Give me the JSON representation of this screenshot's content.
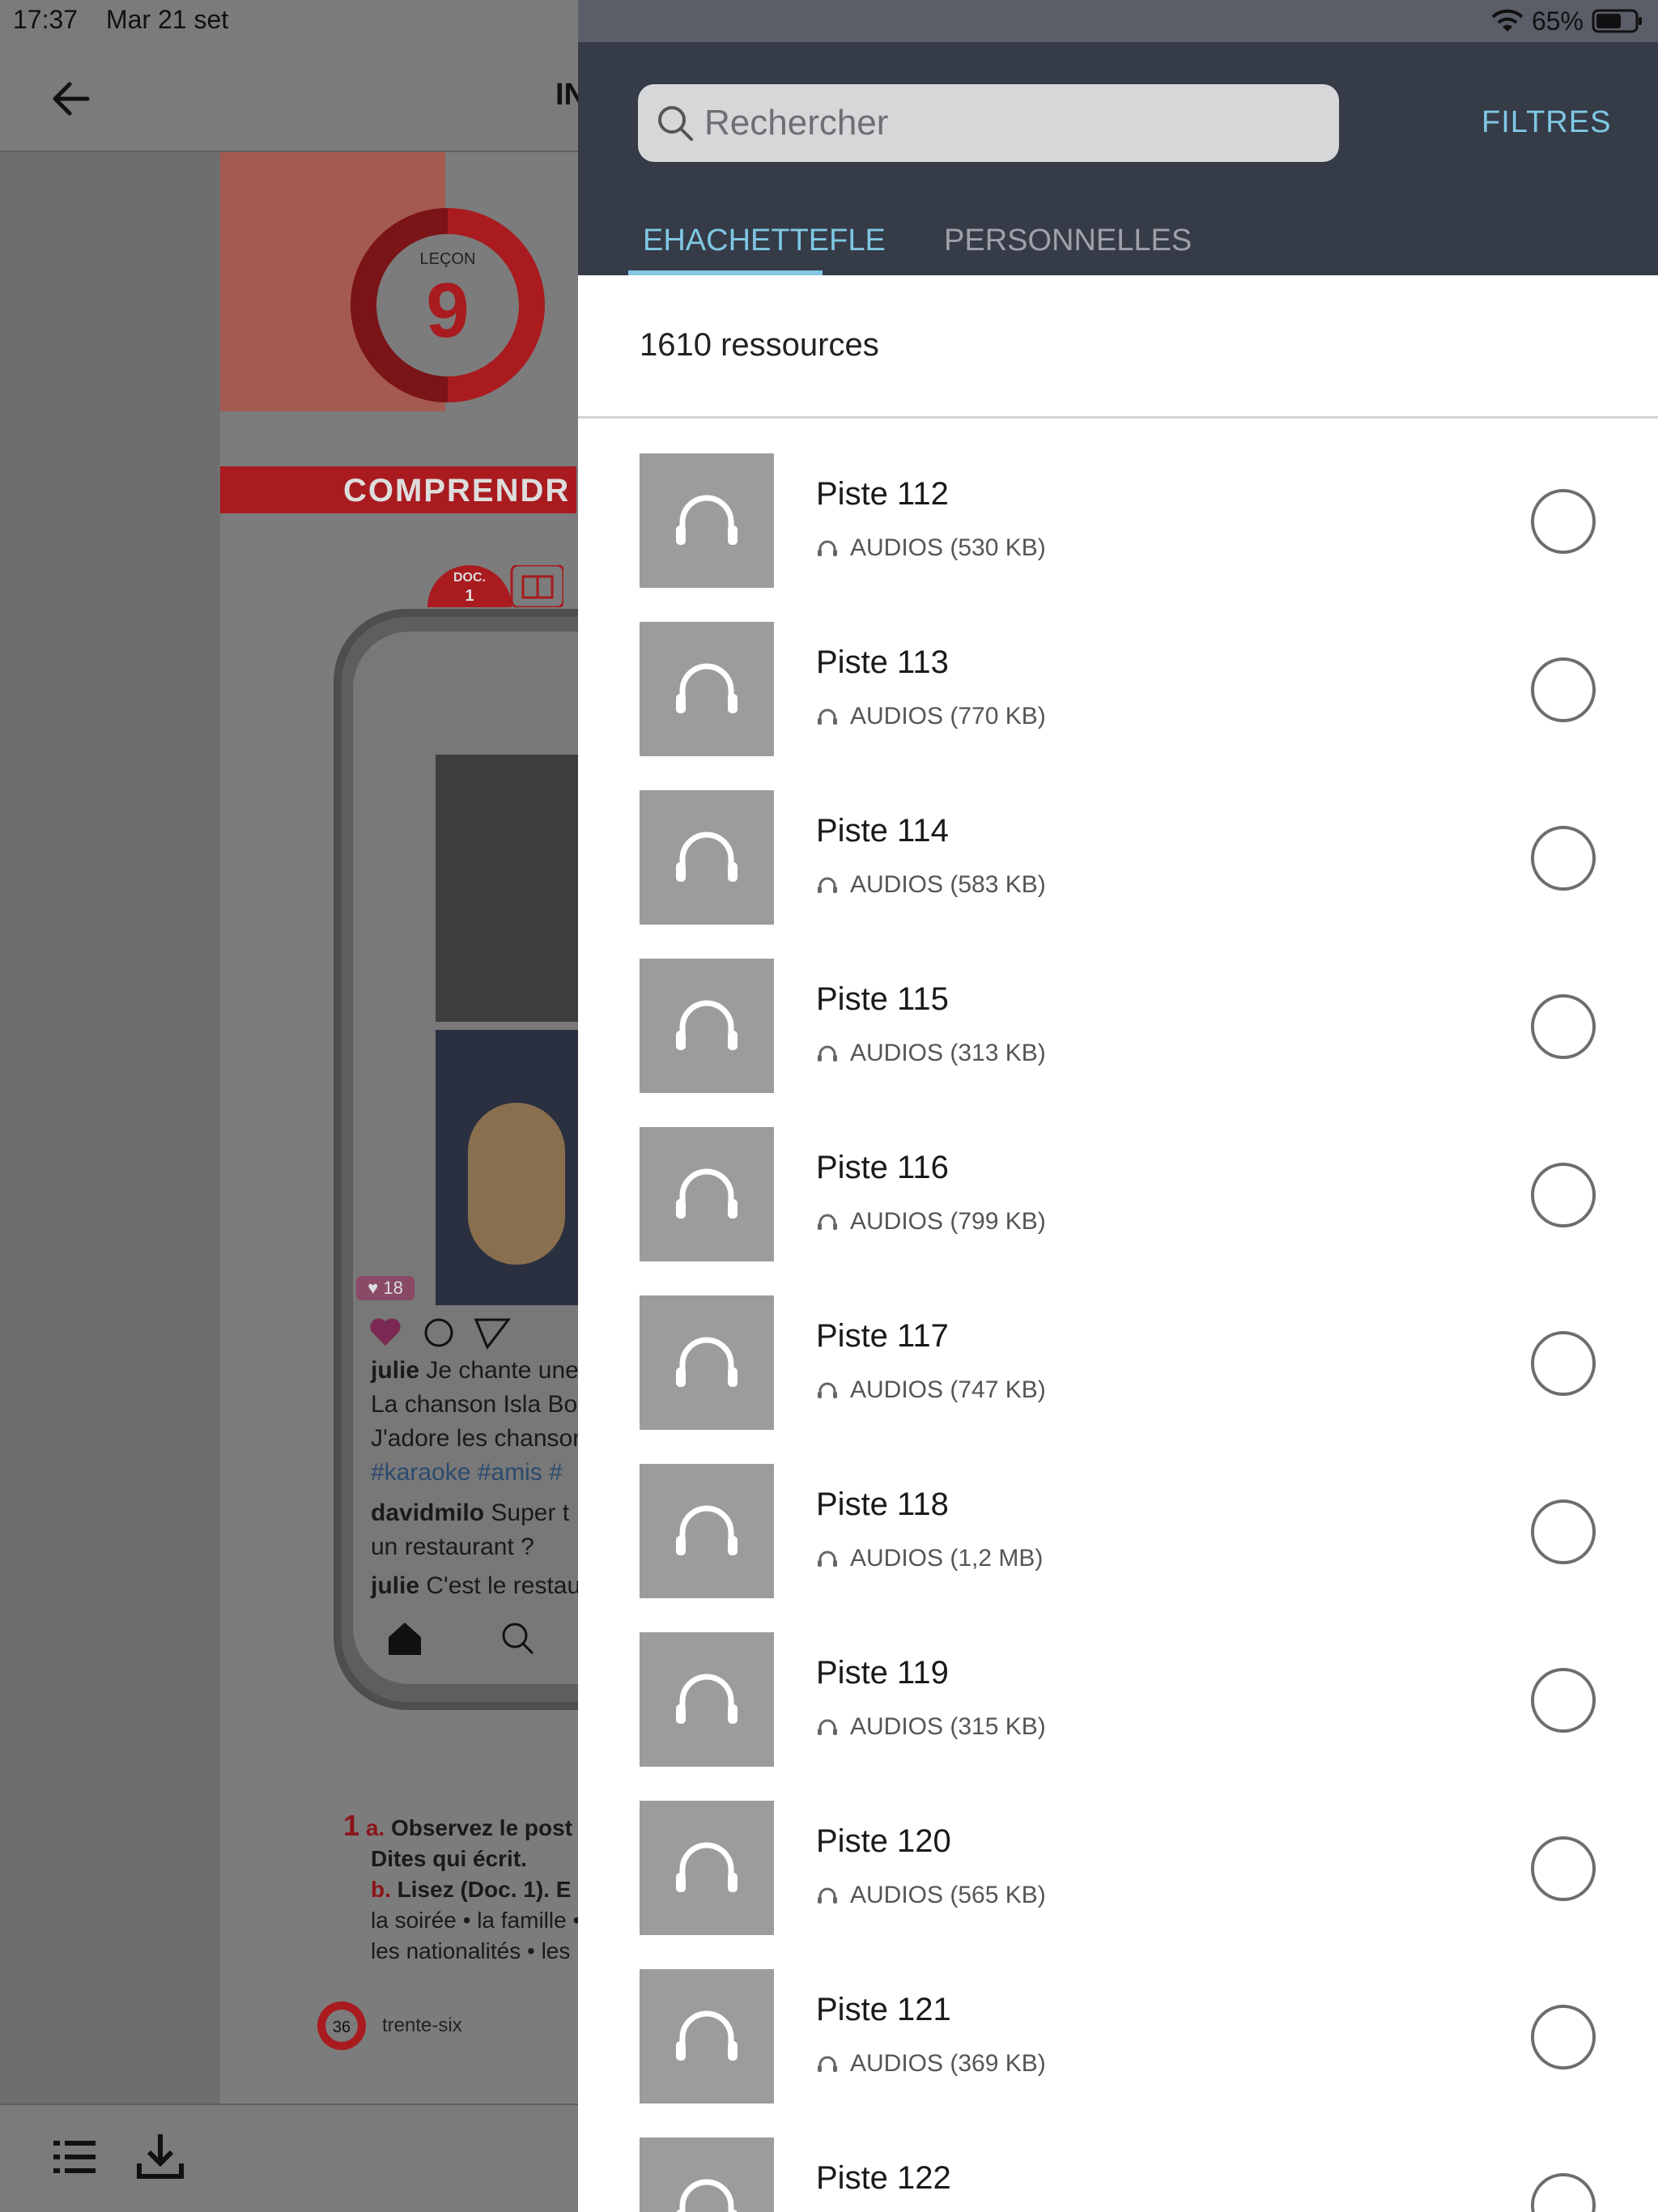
{
  "status_bar": {
    "time": "17:37",
    "date": "Mar 21 set",
    "battery": "65%"
  },
  "background": {
    "title_partial": "IN",
    "lesson_label": "LEÇON",
    "lesson_number": "9",
    "section": "COMPRENDR",
    "doc_label": "DOC.",
    "doc_number": "1",
    "like_count": "18",
    "post_lines": [
      {
        "user": "julie",
        "text": "Je chante une"
      },
      {
        "user": "",
        "text": "La chanson Isla Boni"
      },
      {
        "user": "",
        "text": "J'adore les chansons"
      },
      {
        "user": "",
        "text": "#karaoke  #amis  #"
      },
      {
        "user": "davidmilo",
        "text": "Super t"
      },
      {
        "user": "",
        "text": "un restaurant ?"
      },
      {
        "user": "julie",
        "text": "C'est le restau"
      }
    ],
    "exercise_lines": [
      {
        "num": "1",
        "letter": "a.",
        "text": "Observez le post"
      },
      {
        "num": "",
        "letter": "",
        "text": "Dites qui écrit."
      },
      {
        "num": "",
        "letter": "b.",
        "text": "Lisez (Doc. 1). E"
      },
      {
        "num": "",
        "letter": "",
        "text": "la soirée • la famille •"
      },
      {
        "num": "",
        "letter": "",
        "text": "les nationalités • les"
      }
    ],
    "page_number": "36",
    "page_word": "trente-six"
  },
  "panel": {
    "search_placeholder": "Rechercher",
    "filters_label": "FILTRES",
    "tabs": [
      {
        "label": "EHACHETTEFLE",
        "active": true
      },
      {
        "label": "PERSONNELLES",
        "active": false
      }
    ],
    "resource_count": "1610 ressources",
    "accent_color": "#7ec8e3",
    "items": [
      {
        "title": "Piste 112",
        "meta": "AUDIOS (530 KB)",
        "icon": "headphones-icon"
      },
      {
        "title": "Piste 113",
        "meta": "AUDIOS (770 KB)",
        "icon": "headphones-icon"
      },
      {
        "title": "Piste 114",
        "meta": "AUDIOS (583 KB)",
        "icon": "headphones-icon"
      },
      {
        "title": "Piste 115",
        "meta": "AUDIOS (313 KB)",
        "icon": "headphones-icon"
      },
      {
        "title": "Piste 116",
        "meta": "AUDIOS (799 KB)",
        "icon": "headphones-icon"
      },
      {
        "title": "Piste 117",
        "meta": "AUDIOS (747 KB)",
        "icon": "headphones-icon"
      },
      {
        "title": "Piste 118",
        "meta": "AUDIOS (1,2 MB)",
        "icon": "headphones-icon"
      },
      {
        "title": "Piste 119",
        "meta": "AUDIOS (315 KB)",
        "icon": "headphones-icon"
      },
      {
        "title": "Piste 120",
        "meta": "AUDIOS (565 KB)",
        "icon": "headphones-icon"
      },
      {
        "title": "Piste 121",
        "meta": "AUDIOS (369 KB)",
        "icon": "headphones-icon"
      },
      {
        "title": "Piste 122",
        "meta": "",
        "icon": "headphones-icon"
      }
    ]
  }
}
